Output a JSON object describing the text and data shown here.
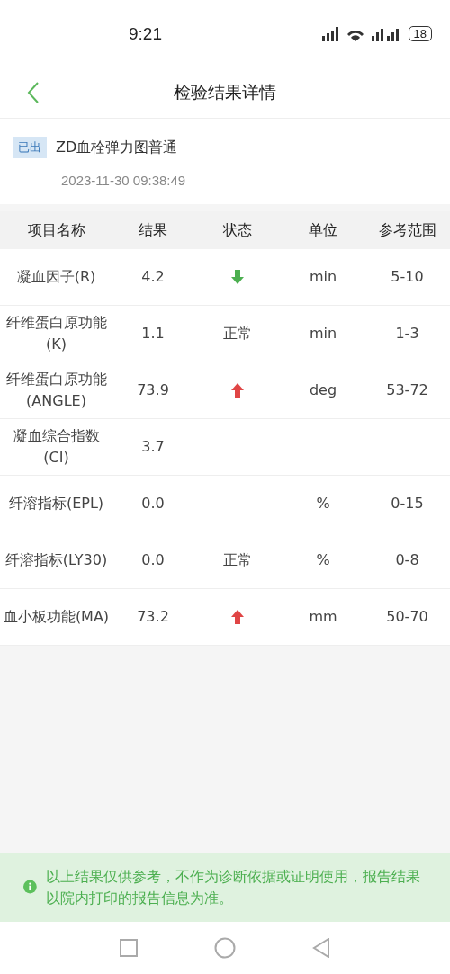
{
  "status_bar": {
    "time": "9:21",
    "battery": "18"
  },
  "header": {
    "title": "检验结果详情"
  },
  "report": {
    "badge": "已出",
    "name": "ZD血栓弹力图普通",
    "datetime": "2023-11-30 09:38:49"
  },
  "table": {
    "columns": [
      "项目名称",
      "结果",
      "状态",
      "单位",
      "参考范围"
    ],
    "rows": [
      {
        "name": "凝血因子(R)",
        "result": "4.2",
        "status": {
          "kind": "down"
        },
        "unit": "min",
        "range": "5-10"
      },
      {
        "name": "纤维蛋白原功能(K)",
        "result": "1.1",
        "status": {
          "kind": "text",
          "text": "正常"
        },
        "unit": "min",
        "range": "1-3"
      },
      {
        "name": "纤维蛋白原功能(ANGLE)",
        "result": "73.9",
        "status": {
          "kind": "up"
        },
        "unit": "deg",
        "range": "53-72"
      },
      {
        "name": "凝血综合指数(CI)",
        "result": "3.7"
      },
      {
        "name": "纤溶指标(EPL)",
        "result": "0.0",
        "unit": "%",
        "range": "0-15"
      },
      {
        "name": "纤溶指标(LY30)",
        "result": "0.0",
        "status": {
          "kind": "text",
          "text": "正常"
        },
        "unit": "%",
        "range": "0-8"
      },
      {
        "name": "血小板功能(MA)",
        "result": "73.2",
        "status": {
          "kind": "up"
        },
        "unit": "mm",
        "range": "50-70"
      }
    ]
  },
  "notice": "以上结果仅供参考，不作为诊断依据或证明使用，报告结果以院内打印的报告信息为准。"
}
